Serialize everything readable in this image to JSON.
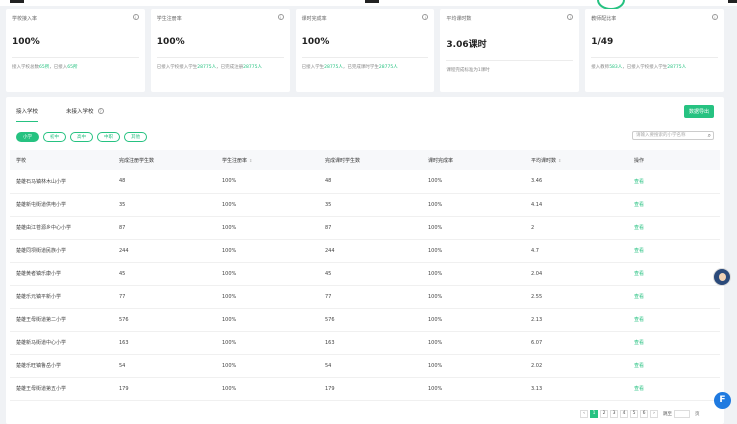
{
  "stats": [
    {
      "title": "学校接入率",
      "value": "100%",
      "sub_pre": "接入学校总数",
      "sub_hl1": "65所",
      "sub_mid": "，已接入",
      "sub_hl2": "65所"
    },
    {
      "title": "学生注册率",
      "value": "100%",
      "sub_pre": "已接入学校接入学生",
      "sub_hl1": "28775人",
      "sub_mid": "，已完成注册",
      "sub_hl2": "28775人"
    },
    {
      "title": "课时完成率",
      "value": "100%",
      "sub_pre": "已接入学生",
      "sub_hl1": "28775人",
      "sub_mid": "，已完成课时学生",
      "sub_hl2": "28775人"
    },
    {
      "title": "平均课时数",
      "value": "3.06课时",
      "sub_pre": "课程完成标准为1课时",
      "sub_hl1": "",
      "sub_mid": "",
      "sub_hl2": ""
    },
    {
      "title": "教师配比率",
      "value": "1/49",
      "sub_pre": "接入教师",
      "sub_hl1": "583人",
      "sub_mid": "，已接入学校接入学生",
      "sub_hl2": "28775人"
    }
  ],
  "tabs": [
    {
      "label": "接入学校",
      "active": true
    },
    {
      "label": "未接入学校",
      "active": false
    }
  ],
  "export_label": "数据导出",
  "filters": [
    "小学",
    "初中",
    "高中",
    "中职",
    "其他"
  ],
  "search_placeholder": "请输入要搜索的小学名称",
  "columns": [
    "学校",
    "完成注册学生数",
    "学生注册率",
    "完成课时学生数",
    "课时完成率",
    "平均课时数",
    "操作"
  ],
  "rows": [
    [
      "楚雄石马镇林木山小学",
      "48",
      "100%",
      "48",
      "100%",
      "3.46",
      "查看"
    ],
    [
      "楚雄新屯街道供电小学",
      "35",
      "100%",
      "35",
      "100%",
      "4.14",
      "查看"
    ],
    [
      "楚雄由江苍源乡中心小学",
      "87",
      "100%",
      "87",
      "100%",
      "2",
      "查看"
    ],
    [
      "楚雄同坝街道民族小学",
      "244",
      "100%",
      "244",
      "100%",
      "4.7",
      "查看"
    ],
    [
      "楚雄黄者镇乐康小学",
      "45",
      "100%",
      "45",
      "100%",
      "2.04",
      "查看"
    ],
    [
      "楚雄乐元镇平新小学",
      "77",
      "100%",
      "77",
      "100%",
      "2.55",
      "查看"
    ],
    [
      "楚雄王母街道第二小学",
      "576",
      "100%",
      "576",
      "100%",
      "2.13",
      "查看"
    ],
    [
      "楚雄新马街道中心小学",
      "163",
      "100%",
      "163",
      "100%",
      "6.07",
      "查看"
    ],
    [
      "楚雄乐旺镇鲁岳小学",
      "54",
      "100%",
      "54",
      "100%",
      "2.02",
      "查看"
    ],
    [
      "楚雄王母街道第五小学",
      "179",
      "100%",
      "179",
      "100%",
      "3.13",
      "查看"
    ]
  ],
  "pagination": {
    "prev": "‹",
    "pages": [
      "1",
      "2",
      "3",
      "4",
      "5",
      "6"
    ],
    "next": "›",
    "jump_label": "跳至",
    "page_suffix": "页"
  },
  "colors": {
    "accent": "#26c281"
  }
}
